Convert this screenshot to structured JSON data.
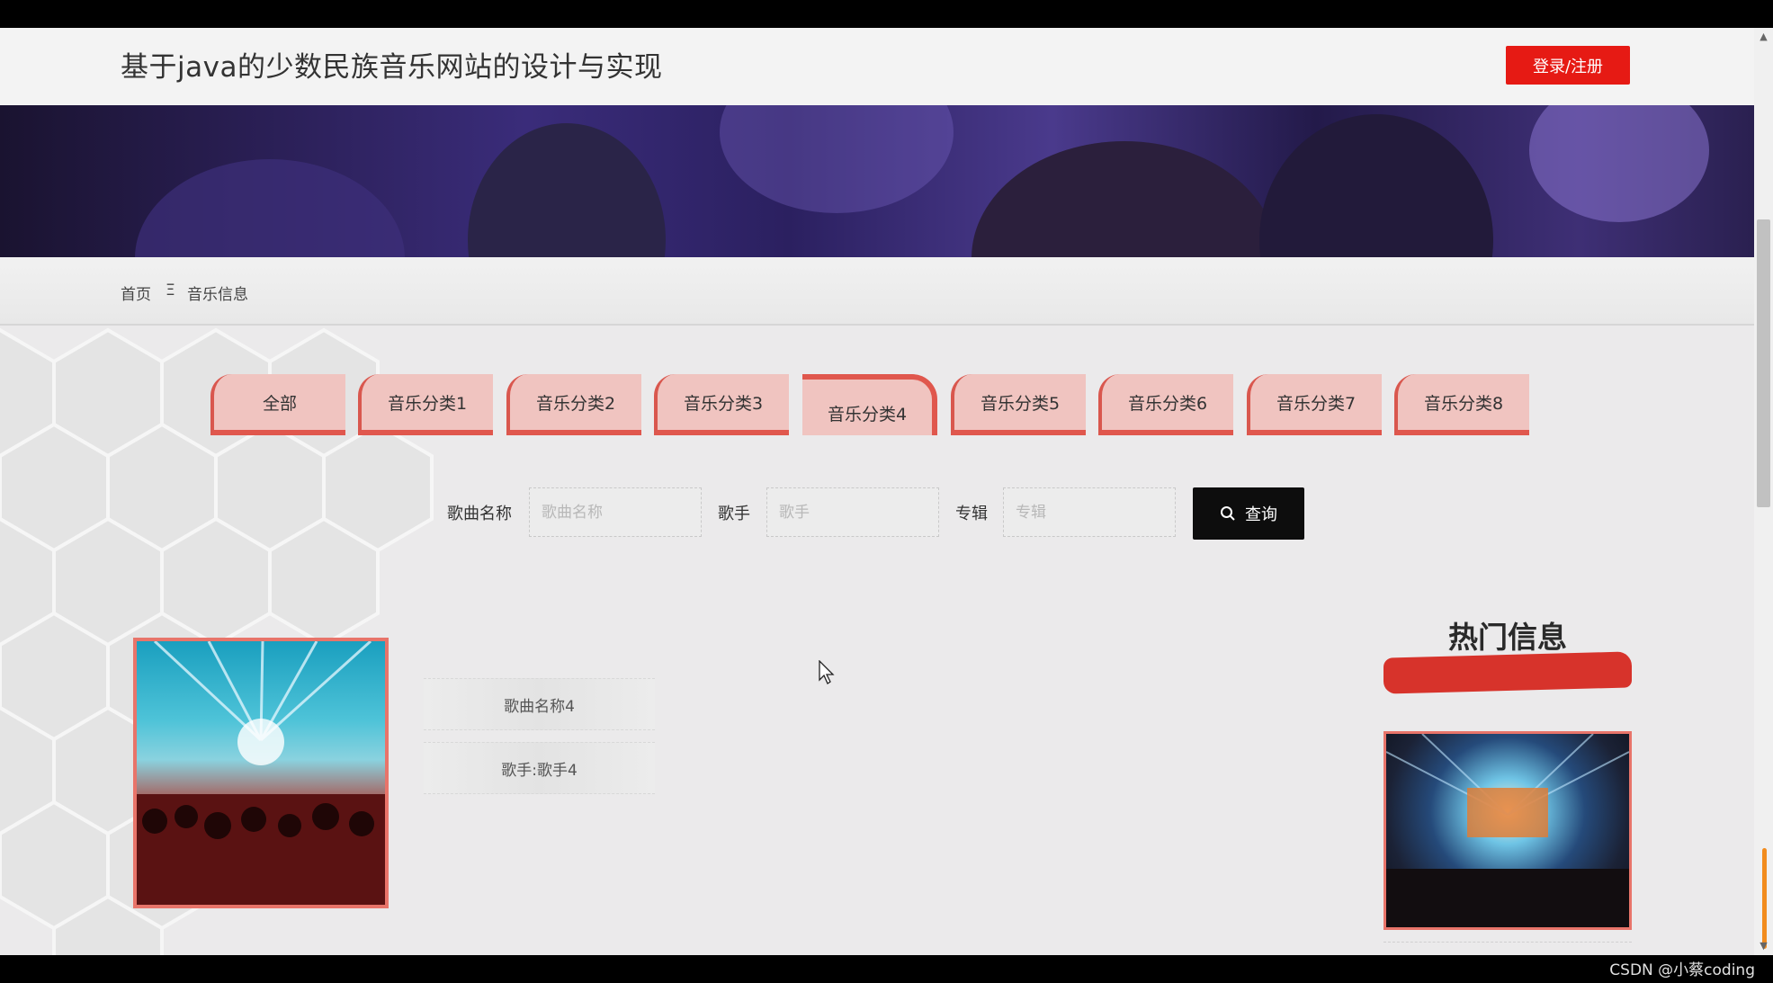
{
  "header": {
    "title": "基于java的少数民族音乐网站的设计与实现",
    "login_label": "登录/注册"
  },
  "breadcrumb": {
    "home": "首页",
    "separator": "Ξ",
    "current": "音乐信息"
  },
  "tabs": [
    {
      "label": "全部",
      "active": false
    },
    {
      "label": "音乐分类1",
      "active": false
    },
    {
      "label": "音乐分类2",
      "active": false
    },
    {
      "label": "音乐分类3",
      "active": false
    },
    {
      "label": "音乐分类4",
      "active": true
    },
    {
      "label": "音乐分类5",
      "active": false
    },
    {
      "label": "音乐分类6",
      "active": false
    },
    {
      "label": "音乐分类7",
      "active": false
    },
    {
      "label": "音乐分类8",
      "active": false
    }
  ],
  "search": {
    "song_label": "歌曲名称",
    "song_placeholder": "歌曲名称",
    "singer_label": "歌手",
    "singer_placeholder": "歌手",
    "album_label": "专辑",
    "album_placeholder": "专辑",
    "button_label": "查询"
  },
  "music_card": {
    "name": "歌曲名称4",
    "singer": "歌手:歌手4"
  },
  "hot": {
    "title": "热门信息"
  },
  "watermark": "CSDN @小蔡coding",
  "colors": {
    "accent_red": "#e61a14",
    "tab_fill": "#f0c4c0",
    "tab_border": "#e0574d",
    "search_button": "#0d0d0d"
  }
}
